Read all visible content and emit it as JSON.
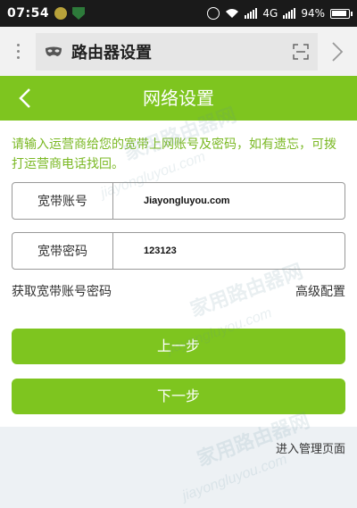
{
  "status_bar": {
    "time": "07:54",
    "network": "4G",
    "battery": "94%",
    "battery_level": 0.94
  },
  "browser": {
    "url_title": "路由器设置"
  },
  "header": {
    "title": "网络设置"
  },
  "instructions": "请输入运营商给您的宽带上网账号及密码，如有遗忘，可拨打运营商电话找回。",
  "form": {
    "account_label": "宽带账号",
    "account_value": "Jiayongluyou.com",
    "password_label": "宽带密码",
    "password_value": "123123"
  },
  "links": {
    "get_account": "获取宽带账号密码",
    "advanced": "高级配置"
  },
  "buttons": {
    "prev": "上一步",
    "next": "下一步"
  },
  "footer": {
    "admin_link": "进入管理页面"
  },
  "watermark": {
    "text_cn": "家用路由器网",
    "text_en": "jiayongluyou.com"
  },
  "colors": {
    "accent": "#7ec51f",
    "instruction_text": "#7ab823",
    "status_bar": "#1a1a1a",
    "footer_bg": "#edf1f4"
  }
}
